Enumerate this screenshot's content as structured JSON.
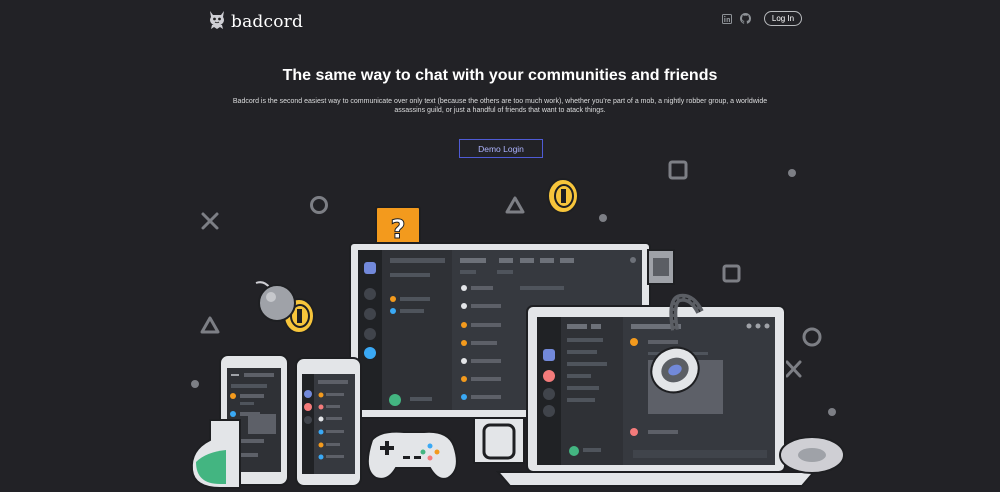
{
  "nav": {
    "brand": "badcord",
    "login_label": "Log In",
    "icons": [
      "linkedin-icon",
      "github-icon"
    ]
  },
  "hero": {
    "title": "The same way to chat with your communities and friends",
    "description": "Badcord is the second easiest way to communicate over only text (because the others are too much work), whether you’re part of a mob, a nightly robber group, a worldwide assassins guild, or just a handful of friends that want to atack things.",
    "demo_label": "Demo Login"
  },
  "colors": {
    "background": "#222226",
    "accent": "#4f5bd5",
    "coin": "#f7c53b",
    "question_block": "#f39a1d",
    "online_green": "#43b581",
    "brand_blurple": "#7289da"
  }
}
